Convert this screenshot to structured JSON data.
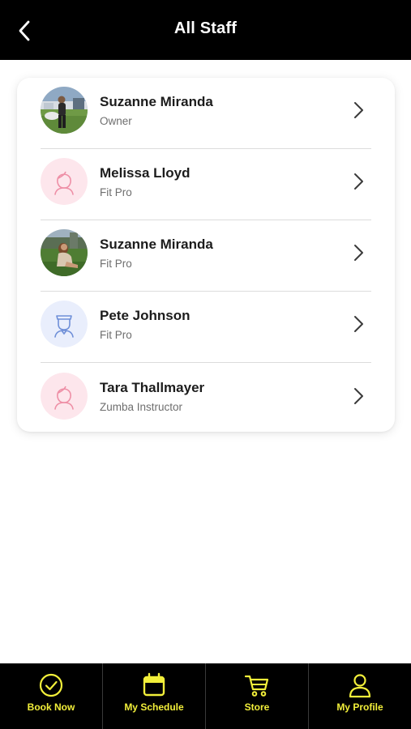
{
  "header": {
    "title": "All Staff"
  },
  "staff": [
    {
      "name": "Suzanne Miranda",
      "role": "Owner",
      "avatar": "photo-athlete-field"
    },
    {
      "name": "Melissa Lloyd",
      "role": "Fit Pro",
      "avatar": "female-placeholder-icon"
    },
    {
      "name": "Suzanne Miranda",
      "role": "Fit Pro",
      "avatar": "photo-sitting-grass"
    },
    {
      "name": "Pete Johnson",
      "role": "Fit Pro",
      "avatar": "male-placeholder-icon"
    },
    {
      "name": "Tara Thallmayer",
      "role": "Zumba Instructor",
      "avatar": "female-placeholder-icon"
    }
  ],
  "tabbar": {
    "items": [
      {
        "label": "Book Now",
        "icon": "check-circle-icon"
      },
      {
        "label": "My Schedule",
        "icon": "calendar-icon"
      },
      {
        "label": "Store",
        "icon": "cart-icon"
      },
      {
        "label": "My Profile",
        "icon": "user-icon"
      }
    ]
  },
  "colors": {
    "header_bg": "#000000",
    "tab_accent": "#f2ef3a",
    "female_avatar_bg": "#fde6ec",
    "female_avatar_stroke": "#ee8fa6",
    "male_avatar_bg": "#e9eefc",
    "male_avatar_stroke": "#6f8fd8"
  }
}
